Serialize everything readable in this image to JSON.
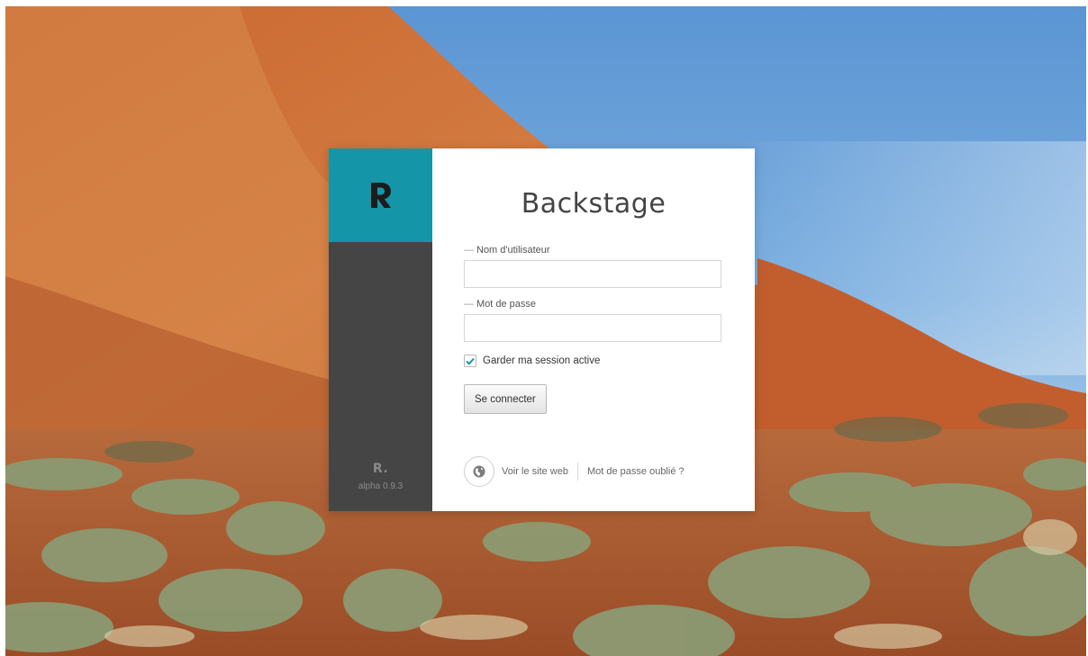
{
  "app": {
    "title": "Backstage",
    "logo_mark": "R.",
    "version": "alpha 0.9.3"
  },
  "login": {
    "username_label": "Nom d'utilisateur",
    "username_value": "",
    "password_label": "Mot de passe",
    "password_value": "",
    "remember_label": "Garder ma session active",
    "remember_checked": true,
    "submit_label": "Se connecter"
  },
  "footer": {
    "visit_site_label": "Voir le site web",
    "forgot_password_label": "Mot de passe oublié ?",
    "globe_icon": "globe-icon"
  },
  "colors": {
    "brand_accent": "#1596a8",
    "sidebar": "#454545",
    "check": "#1596a8"
  }
}
